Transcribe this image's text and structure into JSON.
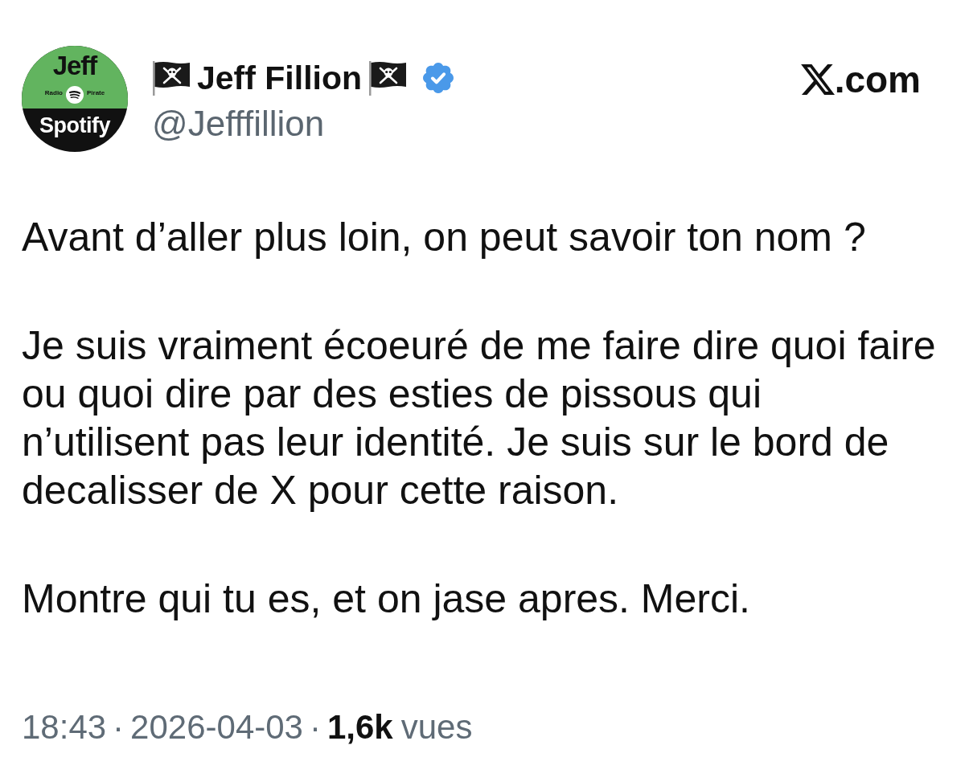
{
  "author": {
    "avatar": {
      "top_text": "Jeff",
      "left_text": "Radio",
      "right_text": "Pirate",
      "bottom_text": "Spotify"
    },
    "display_name": "Jeff Fillion",
    "verified": true,
    "handle": "@Jefffillion"
  },
  "site_label": ".com",
  "tweet": {
    "paragraphs": [
      "Avant d’aller plus loin, on peut savoir ton nom ?",
      "Je suis vraiment écoeuré de me faire dire quoi faire ou quoi dire par des esties de pissous qui n’utilisent pas leur identité. Je suis sur le bord de decalisser de X pour cette raison.",
      "Montre qui tu es, et on jase apres. Merci."
    ]
  },
  "footer": [
    {
      "kind": "time",
      "text": "18:43"
    },
    {
      "kind": "dot",
      "text": "·"
    },
    {
      "kind": "date",
      "text": "2026-04-03"
    },
    {
      "kind": "dot",
      "text": "·"
    },
    {
      "kind": "count",
      "text": "1,6k"
    },
    {
      "kind": "label",
      "text": "vues"
    }
  ]
}
